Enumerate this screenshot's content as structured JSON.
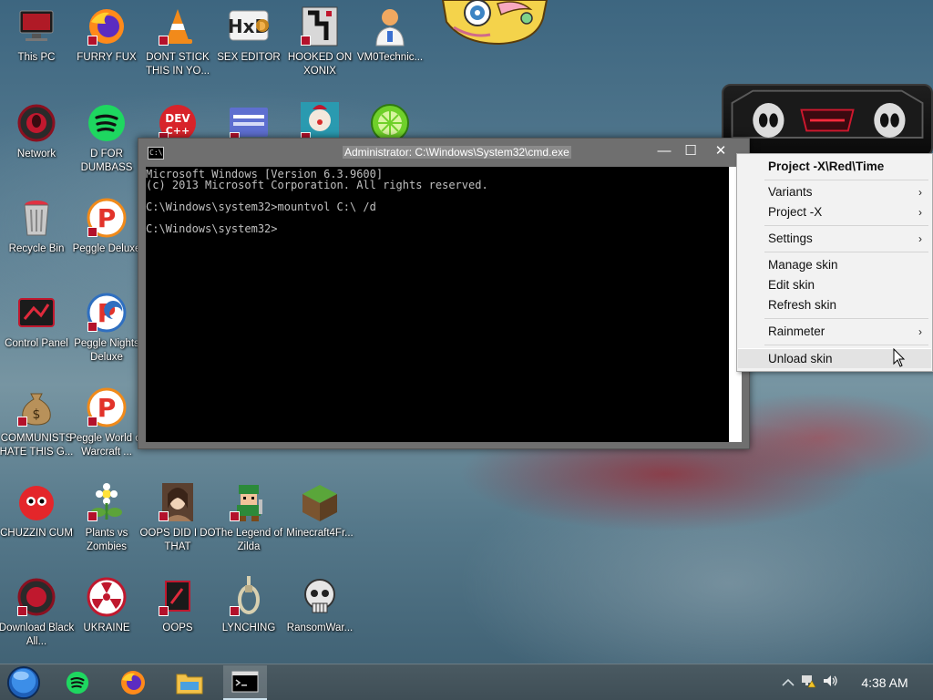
{
  "desktop_icons": [
    {
      "label": "This PC"
    },
    {
      "label": "FURRY FUX"
    },
    {
      "label": "DONT STICK THIS IN YO..."
    },
    {
      "label": "SEX EDITOR"
    },
    {
      "label": "HOOKED ON XONIX"
    },
    {
      "label": "VM0Technic..."
    },
    {
      "label": "Network"
    },
    {
      "label": "D FOR DUMBASS"
    },
    {
      "label": "Recycle Bin"
    },
    {
      "label": "Peggle Deluxe"
    },
    {
      "label": "Control Panel"
    },
    {
      "label": "Peggle Nights Deluxe"
    },
    {
      "label": "COMMUNISTS HATE THIS G..."
    },
    {
      "label": "Peggle World of Warcraft ..."
    },
    {
      "label": "CHUZZIN CUM"
    },
    {
      "label": "Plants vs Zombies"
    },
    {
      "label": "OOPS DID I DO THAT"
    },
    {
      "label": "The Legend of Zilda"
    },
    {
      "label": "Minecraft4Fr..."
    },
    {
      "label": "Download Black All..."
    },
    {
      "label": "UKRAINE"
    },
    {
      "label": "OOPS"
    },
    {
      "label": "LYNCHING"
    },
    {
      "label": "RansomWar..."
    },
    {
      "label": ""
    },
    {
      "label": ""
    },
    {
      "label": ""
    }
  ],
  "cmd_window": {
    "title": "Administrator: C:\\Windows\\System32\\cmd.exe",
    "icon_text": "C:\\",
    "lines": [
      "Microsoft Windows [Version 6.3.9600]",
      "(c) 2013 Microsoft Corporation. All rights reserved.",
      "",
      "C:\\Windows\\system32>mountvol C:\\ /d",
      "",
      "C:\\Windows\\system32>"
    ],
    "minimize_glyph": "—",
    "maximize_glyph": "☐",
    "close_glyph": "✕"
  },
  "context_menu": {
    "header": "Project -X\\Red\\Time",
    "items": [
      {
        "label": "Variants",
        "submenu": true
      },
      {
        "label": "Project -X",
        "submenu": true
      },
      {
        "label": "Settings",
        "submenu": true
      },
      {
        "label": "Manage skin",
        "submenu": false
      },
      {
        "label": "Edit skin",
        "submenu": false
      },
      {
        "label": "Refresh skin",
        "submenu": false
      },
      {
        "label": "Rainmeter",
        "submenu": true
      },
      {
        "label": "Unload skin",
        "submenu": false
      }
    ],
    "arrow_glyph": "›"
  },
  "taskbar": {
    "clock": "4:38 AM",
    "pinned": [
      {
        "name": "start-orb"
      },
      {
        "name": "spotify-icon"
      },
      {
        "name": "firefox-icon"
      },
      {
        "name": "file-explorer-icon"
      },
      {
        "name": "cmd-icon"
      }
    ]
  },
  "colors": {
    "accent_red": "#b3112b",
    "cmd_text": "#c0c0c0",
    "menu_bg": "#f2f2f2"
  }
}
